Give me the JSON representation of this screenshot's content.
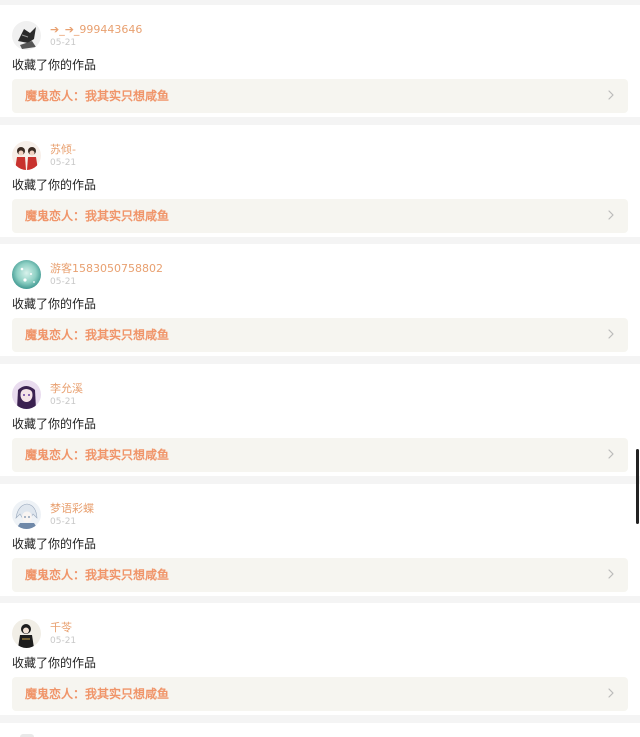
{
  "notifications": [
    {
      "username": "➔_➔_999443646",
      "date": "05-21",
      "action": "收藏了你的作品",
      "work_title": "魔鬼恋人：我其实只想咸鱼",
      "avatar_icon": "sketch-anime-avatar-icon",
      "avatar_colors": [
        "#f0f0f0",
        "#2a2a2a"
      ]
    },
    {
      "username": "苏倾-",
      "date": "05-21",
      "action": "收藏了你的作品",
      "work_title": "魔鬼恋人：我其实只想咸鱼",
      "avatar_icon": "couple-red-avatar-icon",
      "avatar_colors": [
        "#f7efe9",
        "#c8322e"
      ]
    },
    {
      "username": "游客1583050758802",
      "date": "05-21",
      "action": "收藏了你的作品",
      "work_title": "魔鬼恋人：我其实只想咸鱼",
      "avatar_icon": "teal-sparkle-avatar-icon",
      "avatar_colors": [
        "#8ed0c4",
        "#2f8c86"
      ]
    },
    {
      "username": "李允溪",
      "date": "05-21",
      "action": "收藏了你的作品",
      "work_title": "魔鬼恋人：我其实只想咸鱼",
      "avatar_icon": "purple-anime-girl-avatar-icon",
      "avatar_colors": [
        "#e9dcef",
        "#3a2150"
      ]
    },
    {
      "username": "梦语彩蝶",
      "date": "05-21",
      "action": "收藏了你的作品",
      "work_title": "魔鬼恋人：我其实只想咸鱼",
      "avatar_icon": "white-hair-anime-avatar-icon",
      "avatar_colors": [
        "#eef2f6",
        "#6f88a8"
      ]
    },
    {
      "username": "千苓",
      "date": "05-21",
      "action": "收藏了你的作品",
      "work_title": "魔鬼恋人：我其实只想咸鱼",
      "avatar_icon": "dark-figure-avatar-icon",
      "avatar_colors": [
        "#f1eee6",
        "#1d1d1d"
      ]
    }
  ],
  "theme": {
    "username_color": "#e8a070",
    "work_title_color": "#f0956a",
    "work_bg": "#f6f5f0",
    "separator_bg": "#f4f4f4"
  }
}
